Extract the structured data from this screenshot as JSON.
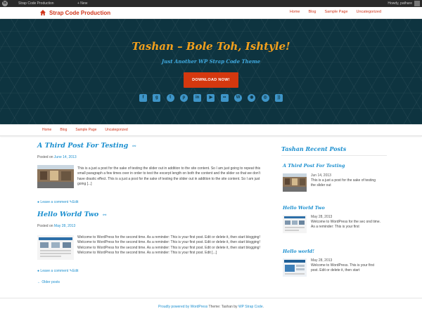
{
  "admin_bar": {
    "site_name": "Strap Code Production",
    "new_label": "+ New",
    "howdy": "Howdy, pathare"
  },
  "top_nav": {
    "brand": "Strap Code Production",
    "items": [
      "Home",
      "Blog",
      "Sample Page",
      "Uncategorized"
    ]
  },
  "header": {
    "title": "Tashan – Bole Toh, Ishtyle!",
    "tagline": "Just Another WP Strap Code Theme",
    "button_label": "DOWNLOAD NOW!",
    "social_icons": [
      "facebook-icon",
      "google-plus-icon",
      "twitter-icon",
      "pinterest-icon",
      "linkedin-icon",
      "youtube-icon",
      "flickr-icon",
      "wordpress-icon",
      "github-icon",
      "dribbble-icon",
      "rss-icon"
    ]
  },
  "sub_nav": {
    "items": [
      "Home",
      "Blog",
      "Sample Page",
      "Uncategorized"
    ]
  },
  "posts": [
    {
      "title": "A Third Post For Testing",
      "posted_prefix": "Posted on",
      "date": "June 14, 2013",
      "excerpt": "This is a just a post for the sake of testing the slider out in addition to the site content. So I am just going to repeat this small paragraph a few times over in order to test the excerpt length on both the content and the slider so that we don't have drastic effect. This is a just a post for the sake of testing the slider out in addition to the site content. So I am just going [...]",
      "comment_label": "Leave a comment",
      "edit_label": "Edit"
    },
    {
      "title": "Hello World Two",
      "posted_prefix": "Posted on",
      "date": "May 28, 2013",
      "excerpt": "Welcome to WordPress for the second time. As a reminder: This is your first post. Edit or delete it, then start blogging! Welcome to WordPress for the second time. As a reminder: This is your first post. Edit or delete it, then start blogging! Welcome to WordPress for the second time. As a reminder: This is your first post. Edit or delete it, then start blogging! Welcome to WordPress for the second time. As a reminder: This is your first post. Edit [...]",
      "comment_label": "Leave a comment",
      "edit_label": "Edit"
    }
  ],
  "older_posts": "← Older posts",
  "sidebar": {
    "title": "Tashan Recent Posts",
    "items": [
      {
        "title": "A Third Post For Testing",
        "date": "Jun 14, 2013",
        "text": "This is a just a post for the sake of testing the slider out"
      },
      {
        "title": "Hello World Two",
        "date": "May 28, 2013",
        "text": "Welcome to WordPress for the sec ond time. As a reminder: This is your first"
      },
      {
        "title": "Hello world!",
        "date": "May 28, 2013",
        "text": "Welcome to WordPress. This is your first post. Edit or delete it, then start"
      }
    ]
  },
  "footer": {
    "powered": "Proudly powered by WordPress",
    "theme_sep": " Theme: Tashan by ",
    "theme_link": "WP Strap Code",
    "end": "."
  }
}
